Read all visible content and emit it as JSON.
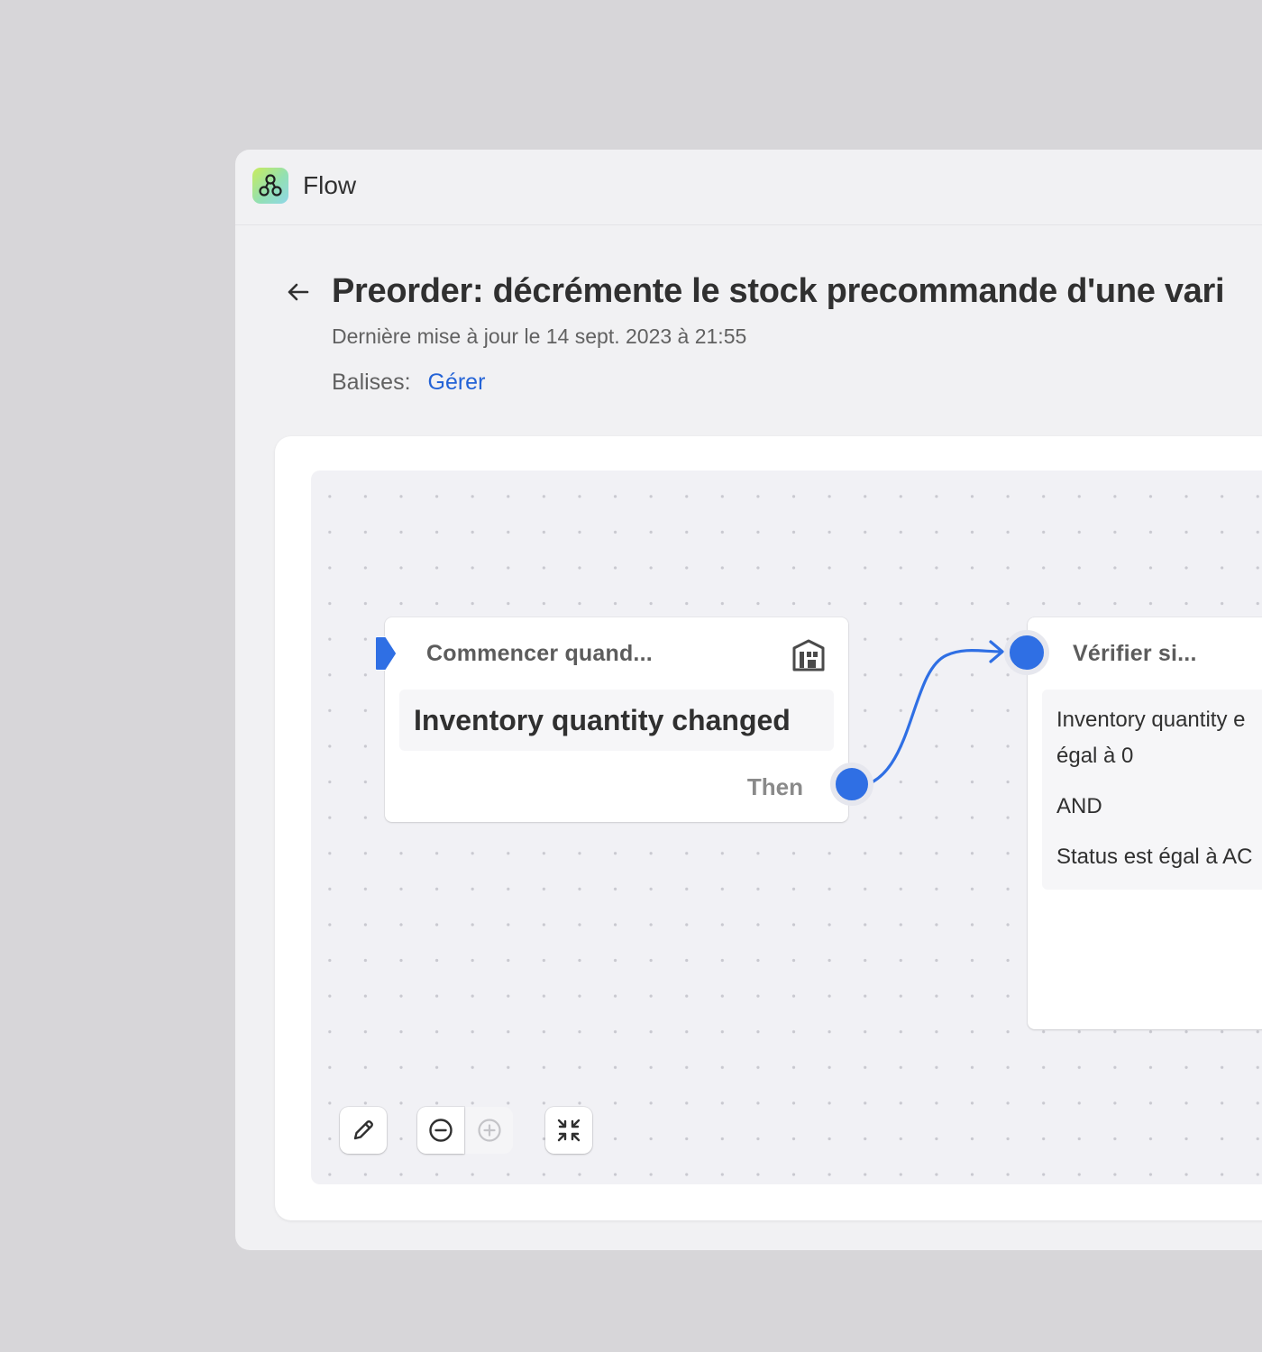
{
  "app": {
    "name": "Flow",
    "logo_icon": "flow-nodes-icon",
    "accent_color": "#2f6fe4",
    "link_color": "#2463d6"
  },
  "header": {
    "back_icon": "arrow-left-icon",
    "title": "Preorder: décrémente le stock precommande d'une vari",
    "last_updated": "Dernière mise à jour le 14 sept. 2023 à 21:55",
    "tags_label": "Balises:",
    "tags_link": "Gérer"
  },
  "canvas": {
    "trigger_node": {
      "header": "Commencer quand...",
      "icon": "store-icon",
      "title": "Inventory quantity changed",
      "then_label": "Then"
    },
    "condition_node": {
      "header": "Vérifier si...",
      "line1": "Inventory quantity e",
      "line2": "égal à 0",
      "operator": "AND",
      "line3": "Status est égal à AC"
    },
    "toolbar": {
      "edit_icon": "pencil-icon",
      "zoom_out_icon": "zoom-out-icon",
      "zoom_in_icon": "zoom-in-icon",
      "fit_icon": "collapse-arrows-icon"
    }
  }
}
